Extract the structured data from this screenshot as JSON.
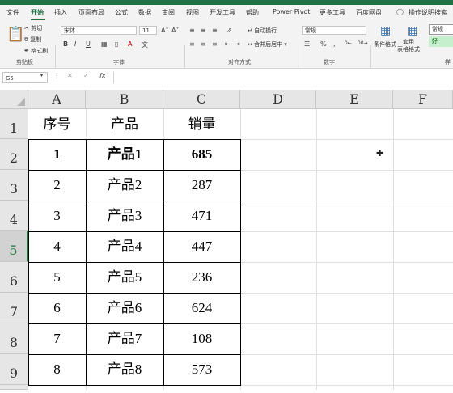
{
  "ribbon_tabs": [
    "文件",
    "开始",
    "插入",
    "页面布局",
    "公式",
    "数据",
    "审阅",
    "视图",
    "开发工具",
    "帮助",
    "Power Pivot",
    "更多工具",
    "百度网盘",
    "操作说明搜索"
  ],
  "clipboard": {
    "cut": "剪切",
    "copy": "复制",
    "painter": "格式刷",
    "group": "剪贴板"
  },
  "font": {
    "name": "宋体",
    "size": "11",
    "group": "字体",
    "bold": "B",
    "italic": "I",
    "underline": "U"
  },
  "align": {
    "wrap": "自动换行",
    "merge": "合并后居中",
    "group": "对齐方式"
  },
  "number": {
    "format": "常规",
    "group": "数字",
    "percent": "%",
    "comma": ","
  },
  "styles": {
    "cond": "条件格式",
    "table": "套用\n表格格式",
    "normal": "常规",
    "good": "好",
    "group": "样"
  },
  "formula_bar": {
    "name_box": "G5",
    "fx": "fx"
  },
  "columns": [
    "A",
    "B",
    "C",
    "D",
    "E",
    "F"
  ],
  "rows": [
    "1",
    "2",
    "3",
    "4",
    "5",
    "6",
    "7",
    "8",
    "9"
  ],
  "table": {
    "headers": [
      "序号",
      "产品",
      "销量"
    ],
    "data": [
      [
        "1",
        "产品1",
        "685"
      ],
      [
        "2",
        "产品2",
        "287"
      ],
      [
        "3",
        "产品3",
        "471"
      ],
      [
        "4",
        "产品4",
        "447"
      ],
      [
        "5",
        "产品5",
        "236"
      ],
      [
        "6",
        "产品6",
        "624"
      ],
      [
        "7",
        "产品7",
        "108"
      ],
      [
        "8",
        "产品8",
        "573"
      ]
    ]
  },
  "accent_color": "#217346"
}
